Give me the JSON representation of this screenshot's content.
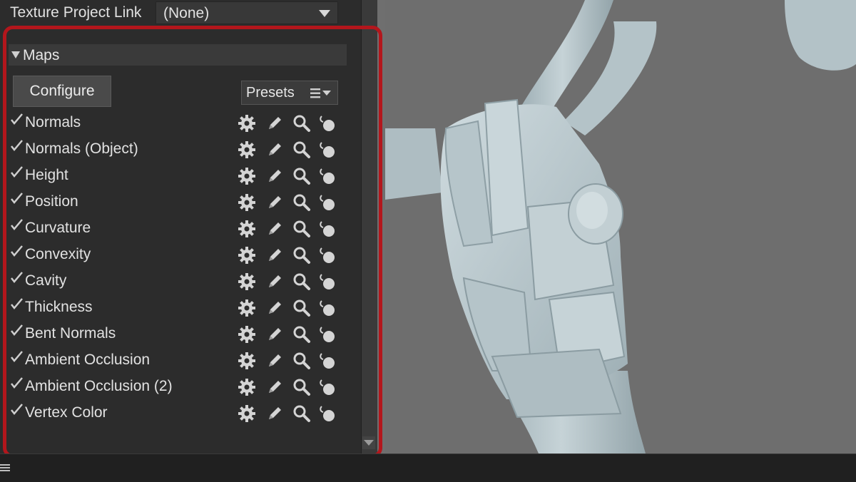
{
  "texture_project_link": {
    "label": "Texture Project Link",
    "value": "(None)"
  },
  "maps": {
    "section_title": "Maps",
    "configure_label": "Configure",
    "presets_label": "Presets",
    "items": [
      {
        "name": "Normals",
        "checked": true
      },
      {
        "name": "Normals (Object)",
        "checked": true
      },
      {
        "name": "Height",
        "checked": true
      },
      {
        "name": "Position",
        "checked": true
      },
      {
        "name": "Curvature",
        "checked": true
      },
      {
        "name": "Convexity",
        "checked": true
      },
      {
        "name": "Cavity",
        "checked": true
      },
      {
        "name": "Thickness",
        "checked": true
      },
      {
        "name": "Bent Normals",
        "checked": true
      },
      {
        "name": "Ambient Occlusion",
        "checked": true
      },
      {
        "name": "Ambient Occlusion (2)",
        "checked": true
      },
      {
        "name": "Vertex Color",
        "checked": true
      }
    ],
    "row_icons": [
      "gear-icon",
      "pencil-icon",
      "magnifier-icon",
      "material-ball-icon"
    ]
  },
  "colors": {
    "panel_bg": "#2c2c2c",
    "highlight": "#b3161c",
    "viewport_bg": "#6e6e6e",
    "model": "#b9c7cc"
  }
}
